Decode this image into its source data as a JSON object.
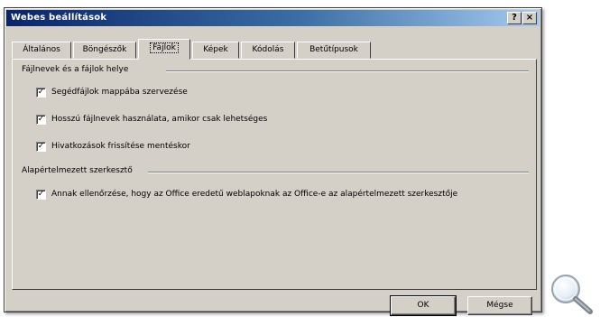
{
  "window": {
    "title": "Webes beállítások",
    "help_label": "?",
    "close_label": "×"
  },
  "tabs": [
    {
      "label": "Általános"
    },
    {
      "label": "Böngészők"
    },
    {
      "label": "Fájlok"
    },
    {
      "label": "Képek"
    },
    {
      "label": "Kódolás"
    },
    {
      "label": "Betűtípusok"
    }
  ],
  "active_tab": "Fájlok",
  "groups": {
    "files": {
      "label": "Fájlnevek és a fájlok helye",
      "options": [
        {
          "label": "Segédfájlok mappába szervezése",
          "checked": true,
          "check": "✓"
        },
        {
          "label": "Hosszú fájlnevek használata, amikor csak lehetséges",
          "checked": true,
          "check": "✓"
        },
        {
          "label": "Hivatkozások frissítése mentéskor",
          "checked": true,
          "check": "✓"
        }
      ]
    },
    "editor": {
      "label": "Alapértelmezett szerkesztő",
      "options": [
        {
          "label": "Annak ellenőrzése, hogy az Office eredetű weblapoknak az Office-e az alapértelmezett szerkesztője",
          "checked": true,
          "check": "✓"
        }
      ]
    }
  },
  "buttons": {
    "ok": "OK",
    "cancel": "Mégse"
  },
  "icons": {
    "corner": "magnifier-icon"
  },
  "colors": {
    "face": "#d4d0c8",
    "title_start": "#0a246a",
    "title_end": "#a6caf0"
  }
}
